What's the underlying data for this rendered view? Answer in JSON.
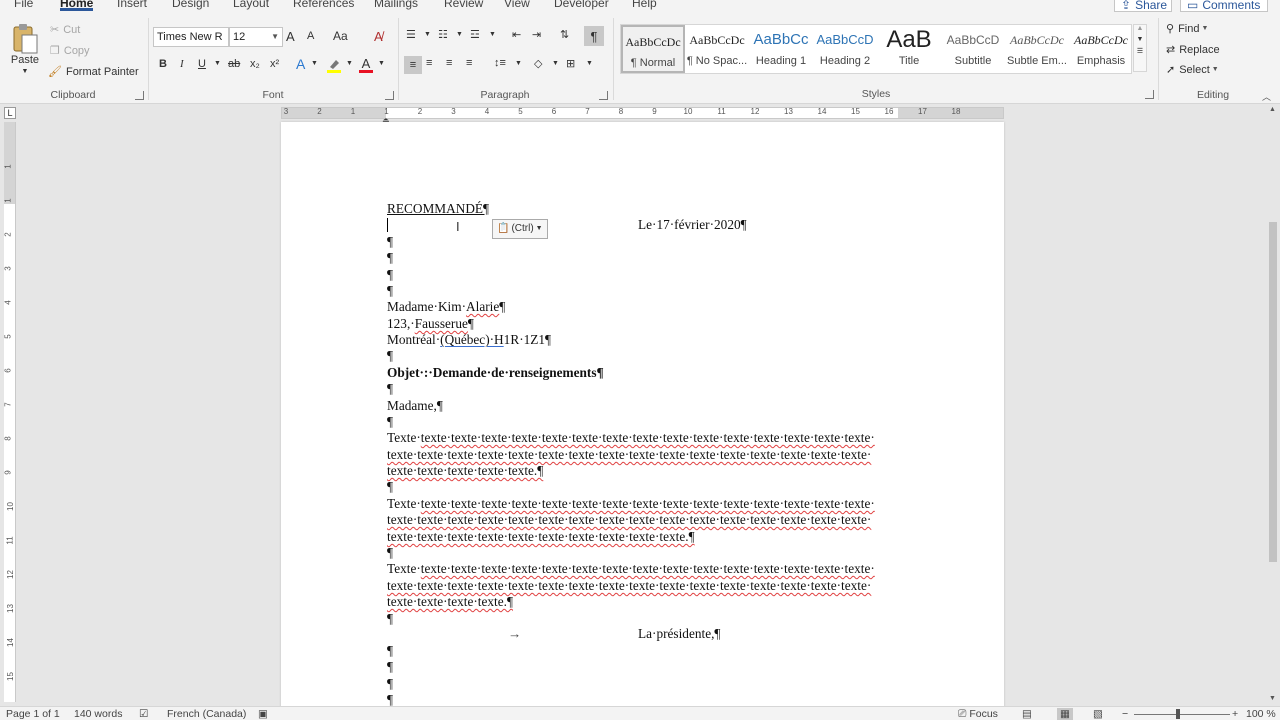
{
  "tabs": [
    "File",
    "Home",
    "Insert",
    "Design",
    "Layout",
    "References",
    "Mailings",
    "Review",
    "View",
    "Developer",
    "Help"
  ],
  "active_tab": "Home",
  "top_buttons": {
    "share": "Share",
    "comments": "Comments"
  },
  "clipboard": {
    "paste": "Paste",
    "cut": "Cut",
    "copy": "Copy",
    "format_painter": "Format Painter",
    "label": "Clipboard"
  },
  "font": {
    "name": "Times New R",
    "size": "12",
    "label": "Font",
    "grow": "A",
    "shrink": "A",
    "case": "Aa",
    "bold": "B",
    "italic": "I",
    "underline": "U",
    "strike": "ab",
    "sub": "x₂",
    "sup": "x²",
    "effects": "A",
    "color": "A"
  },
  "paragraph": {
    "label": "Paragraph",
    "pilcrow": "¶"
  },
  "styles": {
    "label": "Styles",
    "items": [
      {
        "preview": "AaBbCcDc",
        "name": "¶ Normal"
      },
      {
        "preview": "AaBbCcDc",
        "name": "¶ No Spac..."
      },
      {
        "preview": "AaBbCc",
        "name": "Heading 1"
      },
      {
        "preview": "AaBbCcD",
        "name": "Heading 2"
      },
      {
        "preview": "AaB",
        "name": "Title"
      },
      {
        "preview": "AaBbCcD",
        "name": "Subtitle"
      },
      {
        "preview": "AaBbCcDc",
        "name": "Subtle Em..."
      },
      {
        "preview": "AaBbCcDc",
        "name": "Emphasis"
      }
    ]
  },
  "editing": {
    "find": "Find",
    "replace": "Replace",
    "select": "Select",
    "label": "Editing"
  },
  "colors": {
    "accent": "#2b579a",
    "highlight": "#ffff00",
    "font_color": "#e81123",
    "spell": "#e04040"
  },
  "ruler_numbers": [
    "3",
    "2",
    "1",
    "1",
    "2",
    "3",
    "4",
    "5",
    "6",
    "7",
    "8",
    "9",
    "10",
    "11",
    "12",
    "13",
    "14",
    "15",
    "16",
    "17",
    "18"
  ],
  "vruler_numbers": [
    "1",
    "1",
    "2",
    "3",
    "4",
    "5",
    "6",
    "7",
    "8",
    "9",
    "10",
    "11",
    "12",
    "13",
    "14",
    "15"
  ],
  "paste_options": "(Ctrl)",
  "document": {
    "recommande": "RECOMMANDÉ¶",
    "date": "Le·17·février·2020¶",
    "pilcrow": "¶",
    "addr_name": [
      "Madame·Kim·",
      "Alarie",
      "¶"
    ],
    "addr_street": [
      "123,·",
      "Fausserue",
      "¶"
    ],
    "addr_city": [
      "Montréal·",
      "(Québec)·H",
      "1R·1Z1¶"
    ],
    "subject": "Objet·:·Demande·de·renseignements¶",
    "salutation": "Madame,¶",
    "texte_first": "Texte·",
    "p1": [
      "texte·texte·texte·texte·texte·texte·texte·texte·texte·texte·texte·texte·texte·texte·texte·",
      "texte·texte·texte·texte·texte·texte·texte·texte·texte·texte·texte·texte·texte·texte·texte·texte·",
      "texte·texte·texte·texte·texte.¶"
    ],
    "p2": [
      "texte·texte·texte·texte·texte·texte·texte·texte·texte·texte·texte·texte·texte·texte·texte·",
      "texte·texte·texte·texte·texte·texte·texte·texte·texte·texte·texte·texte·texte·texte·texte·texte·",
      "texte·texte·texte·texte·texte·texte·texte·texte·texte·texte.¶"
    ],
    "p3": [
      "texte·texte·texte·texte·texte·texte·texte·texte·texte·texte·texte·texte·texte·texte·texte·",
      "texte·texte·texte·texte·texte·texte·texte·texte·texte·texte·texte·texte·texte·texte·texte·texte·",
      "texte·texte·texte·texte.¶"
    ],
    "tab_arrow": "→",
    "signature": "La·présidente,¶"
  },
  "status": {
    "page": "Page 1 of 1",
    "words": "140 words",
    "language": "French (Canada)",
    "focus": "Focus",
    "zoom": "100 %"
  }
}
